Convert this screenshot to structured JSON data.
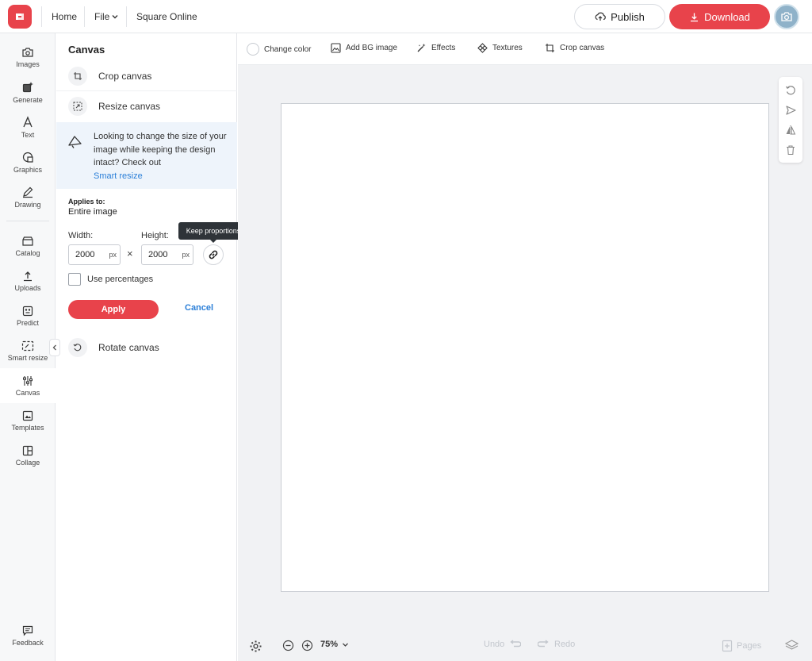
{
  "header": {
    "home": "Home",
    "file": "File",
    "project": "Square Online",
    "publish": "Publish",
    "download": "Download"
  },
  "rail": {
    "items": [
      {
        "label": "Images",
        "icon": "camera-icon"
      },
      {
        "label": "Generate",
        "icon": "sparkle-icon"
      },
      {
        "label": "Text",
        "icon": "text-icon"
      },
      {
        "label": "Graphics",
        "icon": "shapes-icon"
      },
      {
        "label": "Drawing",
        "icon": "pen-icon"
      },
      {
        "label": "Catalog",
        "icon": "catalog-icon"
      },
      {
        "label": "Uploads",
        "icon": "upload-icon"
      },
      {
        "label": "Predict",
        "icon": "predict-icon"
      },
      {
        "label": "Smart resize",
        "icon": "smart-resize-icon"
      },
      {
        "label": "Canvas",
        "icon": "canvas-sliders-icon"
      },
      {
        "label": "Templates",
        "icon": "templates-icon"
      },
      {
        "label": "Collage",
        "icon": "collage-icon"
      }
    ],
    "active": "Canvas",
    "feedback": "Feedback"
  },
  "panel": {
    "title": "Canvas",
    "crop": "Crop canvas",
    "resize": "Resize canvas",
    "info": "Looking to change the size of your image while keeping the design intact? Check out",
    "info_link": "Smart resize",
    "applies_label": "Applies to:",
    "applies_value": "Entire image",
    "width_label": "Width:",
    "height_label": "Height:",
    "width_value": "2000",
    "height_value": "2000",
    "unit": "px",
    "times": "×",
    "tooltip": "Keep proportions",
    "use_percentages": "Use percentages",
    "apply": "Apply",
    "cancel": "Cancel",
    "rotate": "Rotate canvas"
  },
  "toolbar": {
    "change_color": "Change color",
    "add_bg": "Add BG image",
    "effects": "Effects",
    "textures": "Textures",
    "crop": "Crop canvas"
  },
  "bottom": {
    "zoom": "75%",
    "undo": "Undo",
    "redo": "Redo",
    "pages": "Pages"
  },
  "colors": {
    "accent": "#e8434b",
    "link": "#2b7fd8",
    "info_bg": "#eef4fb"
  }
}
